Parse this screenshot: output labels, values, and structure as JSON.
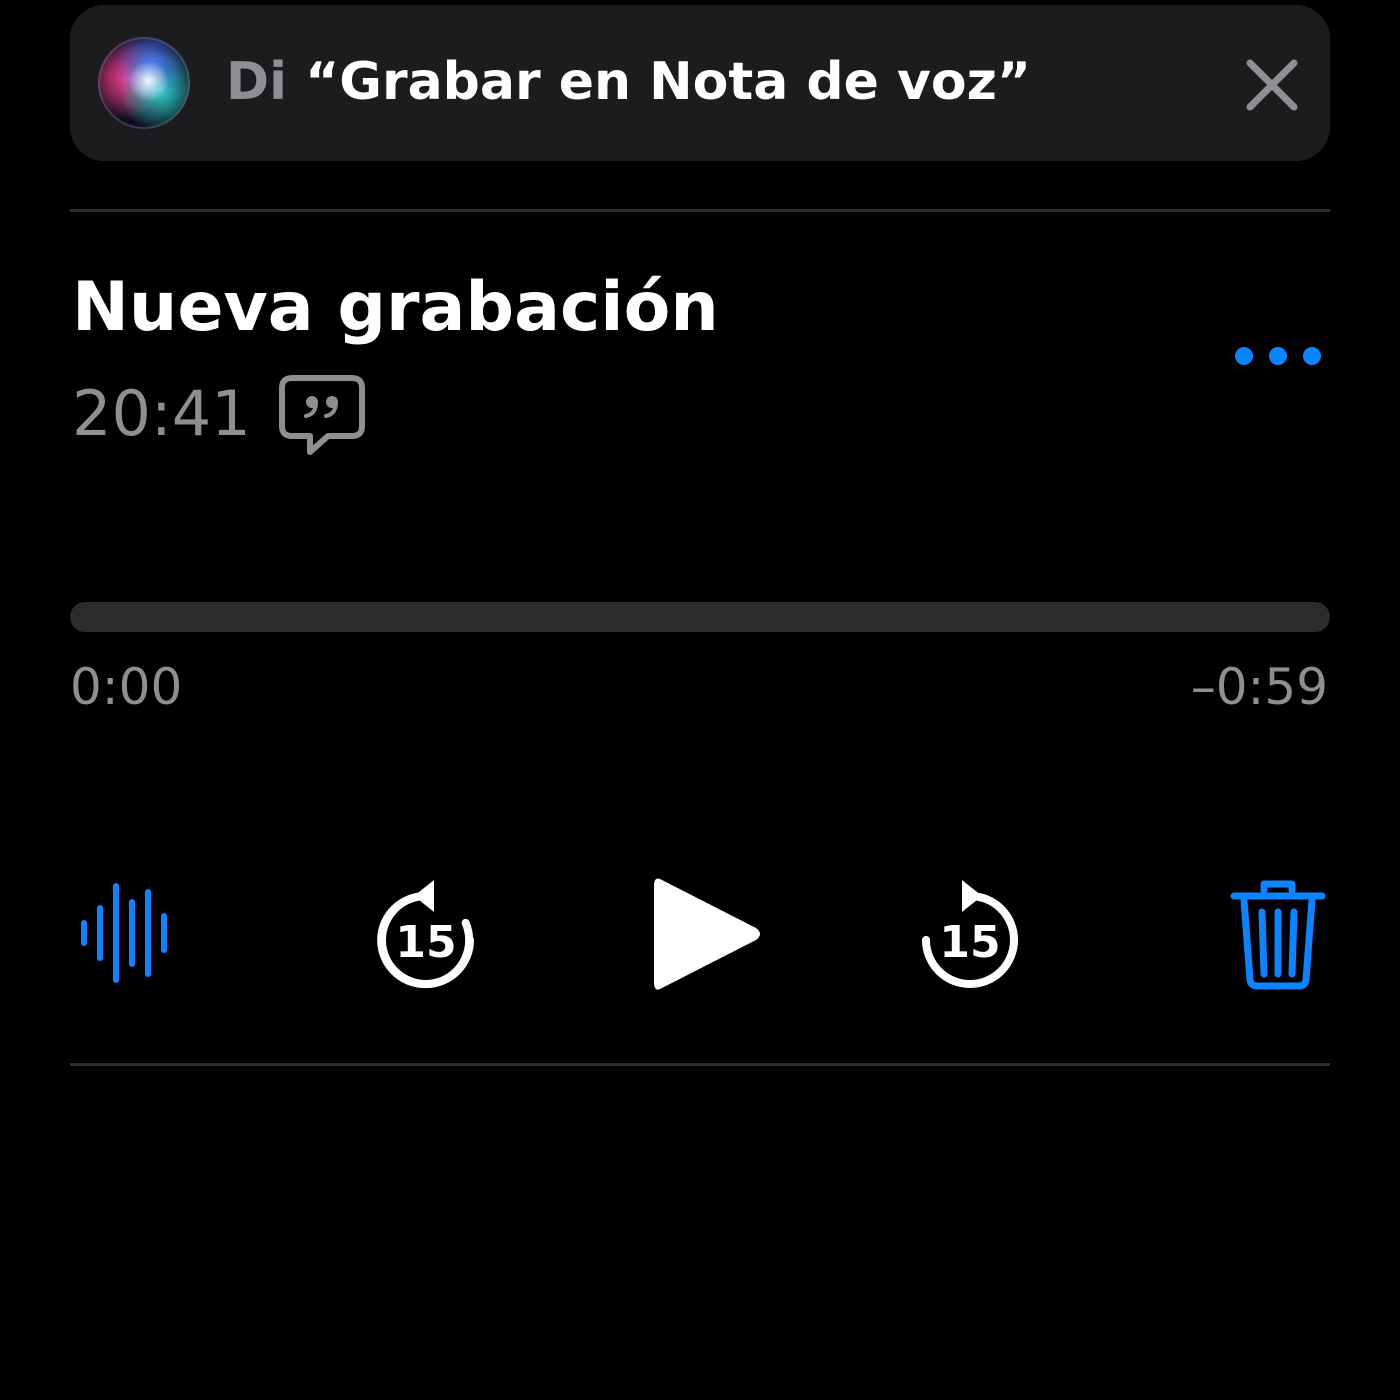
{
  "siri_banner": {
    "prefix": "Di ",
    "phrase": "“Grabar en Nota de voz”",
    "orb_icon": "siri-orb-icon",
    "close_icon": "close-icon"
  },
  "recording": {
    "title": "Nueva grabación",
    "time": "20:41",
    "transcript_icon": "transcript-quote-bubble-icon",
    "more_icon": "ellipsis-icon"
  },
  "playback": {
    "progress_fraction": 0,
    "elapsed": "0:00",
    "remaining": "–0:59"
  },
  "controls": {
    "waveform_icon": "waveform-icon",
    "skip_back_icon": "skip-back-15-icon",
    "skip_back_label": "15",
    "play_icon": "play-icon",
    "skip_forward_icon": "skip-forward-15-icon",
    "skip_forward_label": "15",
    "delete_icon": "trash-icon"
  },
  "colors": {
    "background": "#000000",
    "banner": "#1c1c1e",
    "accent": "#0a84ff",
    "secondary_text": "#8e8e93",
    "primary_text": "#ffffff",
    "track": "#2c2c2e"
  }
}
